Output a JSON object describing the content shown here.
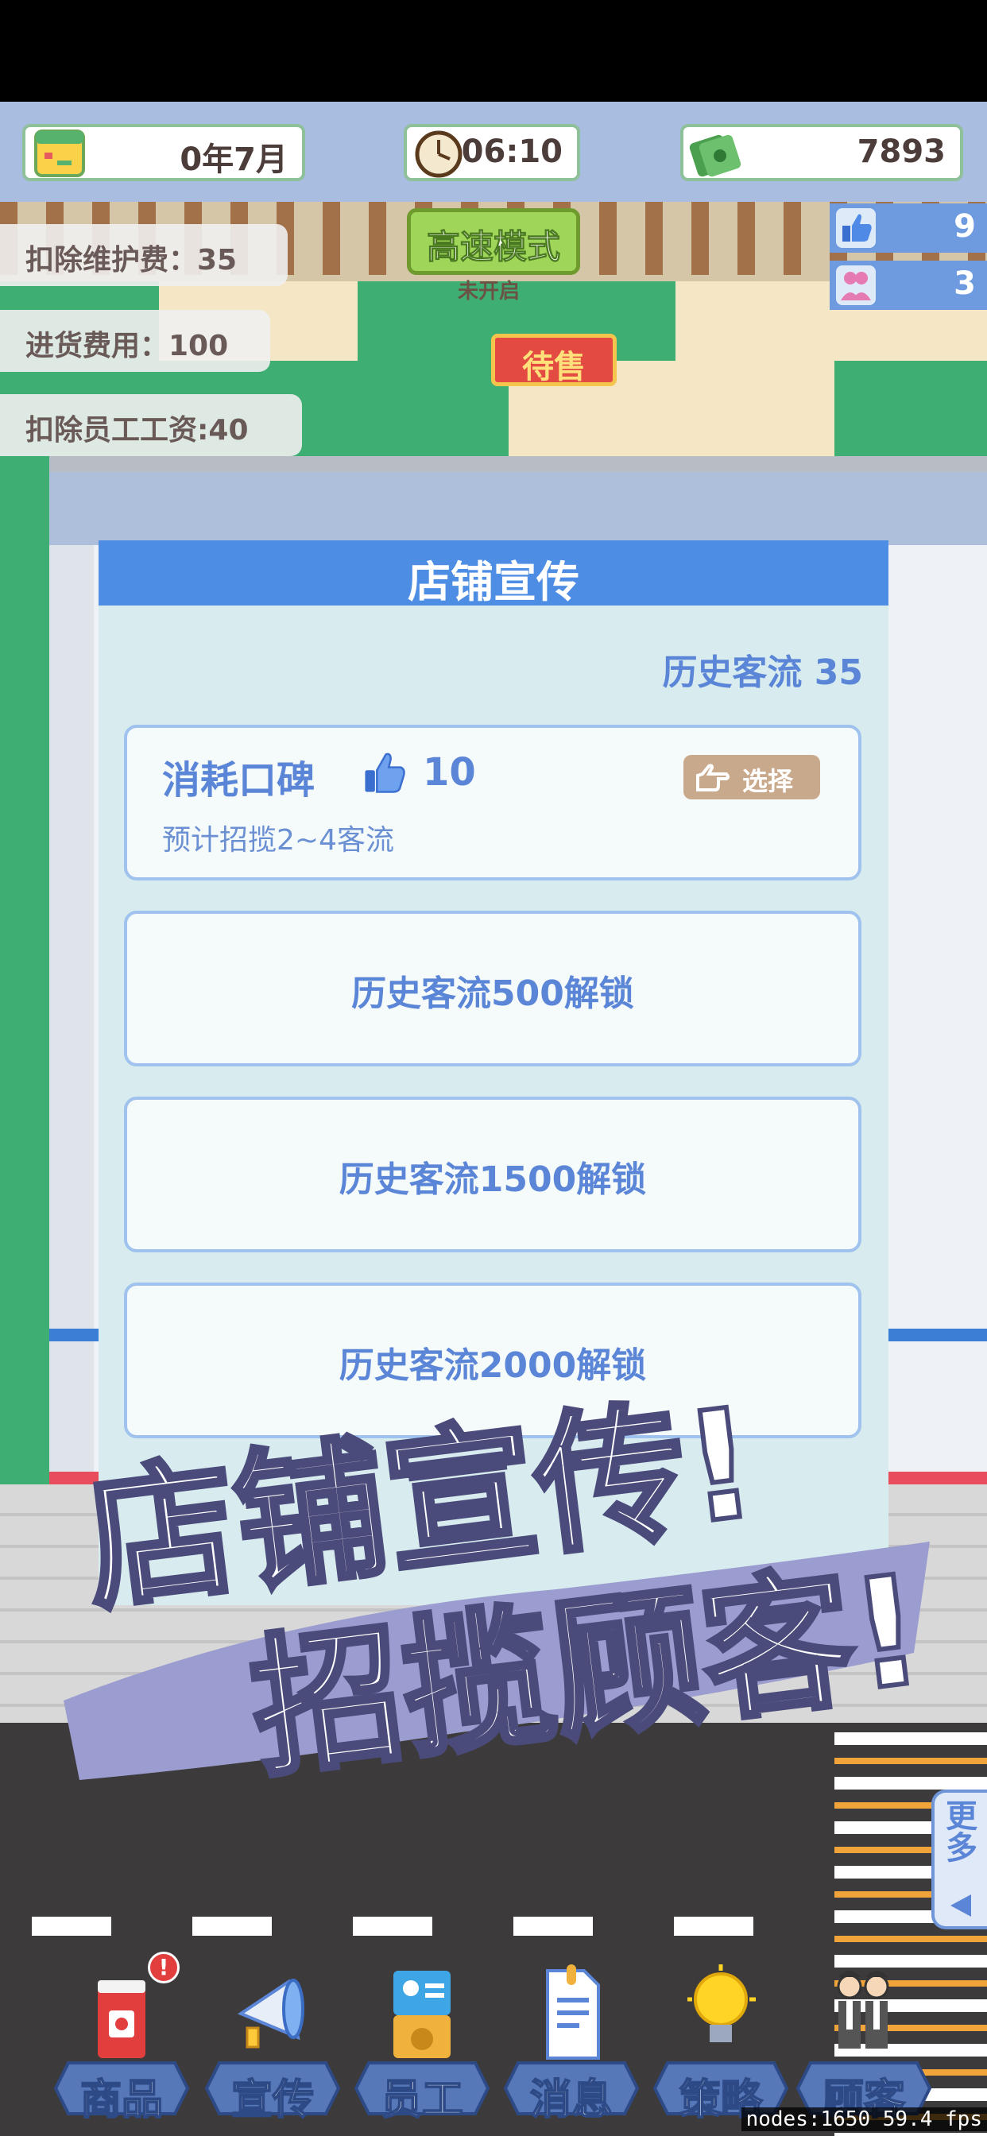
{
  "topbar": {
    "date": "0年7月",
    "time": "06:10",
    "money": "7893"
  },
  "notices": [
    {
      "text": "扣除维护费：35"
    },
    {
      "text": "进货费用：100"
    },
    {
      "text": "扣除员工工资:40"
    }
  ],
  "speed_mode": {
    "label": "高速模式",
    "status": "未开启"
  },
  "for_sale_sign": "待售",
  "side_counts": [
    {
      "icon": "thumbs-up-icon",
      "value": "9"
    },
    {
      "icon": "customers-icon",
      "value": "3"
    }
  ],
  "panel": {
    "title": "店铺宣传",
    "history_traffic": "历史客流 35",
    "option": {
      "title": "消耗口碑",
      "cost": "10",
      "desc": "预计招揽2~4客流",
      "select_label": "选择"
    },
    "locked": [
      "历史客流500解锁",
      "历史客流1500解锁",
      "历史客流2000解锁"
    ]
  },
  "slogan": {
    "line1": "店铺宣传!",
    "line2": "招揽顾客!"
  },
  "more_button": {
    "label": "更多"
  },
  "nav": [
    {
      "label": "商品",
      "icon": "paint-bucket-icon",
      "badge": "!"
    },
    {
      "label": "宣传",
      "icon": "megaphone-icon"
    },
    {
      "label": "员工",
      "icon": "employee-card-icon"
    },
    {
      "label": "消息",
      "icon": "document-icon"
    },
    {
      "label": "策略",
      "icon": "lightbulb-icon"
    },
    {
      "label": "顾客",
      "icon": "customers-icon"
    }
  ],
  "debug": "nodes:1650   59.4 fps"
}
